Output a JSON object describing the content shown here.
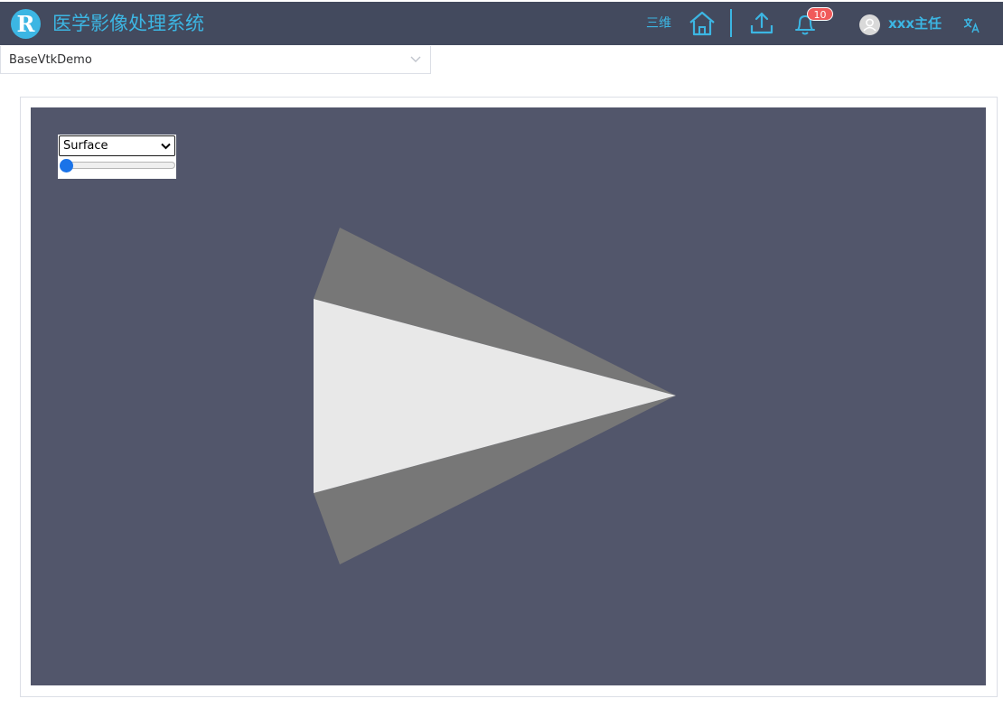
{
  "header": {
    "logo_letter": "R",
    "title": "医学影像处理系统",
    "mode_label": "三维",
    "notifications": {
      "count": "10"
    },
    "user": {
      "name": "xxx主任"
    }
  },
  "demo_selector": {
    "value": "BaseVtkDemo"
  },
  "viewer": {
    "representation": {
      "selected": "Surface"
    },
    "slider": {
      "value": 0.0
    },
    "colors": {
      "background": "#52566b",
      "front_face": "#e8e8e8",
      "side_faces": "#777777"
    }
  }
}
